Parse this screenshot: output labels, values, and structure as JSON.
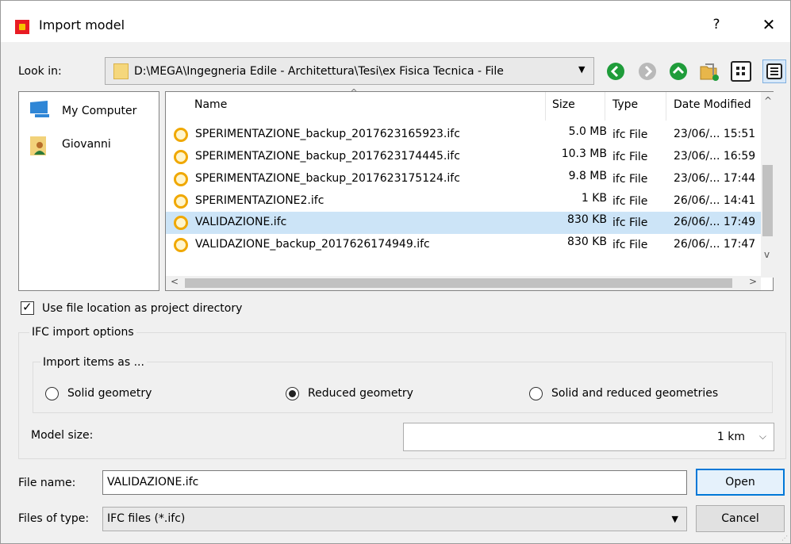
{
  "window": {
    "title": "Import model",
    "help_label": "?",
    "close_label": "✕"
  },
  "look_in": {
    "label": "Look in:",
    "path": "D:\\MEGA\\Ingegneria Edile - Architettura\\Tesi\\ex Fisica Tecnica - File",
    "arrow": "▼"
  },
  "places": [
    {
      "label": "My Computer",
      "icon": "computer-icon"
    },
    {
      "label": "Giovanni",
      "icon": "user-folder-icon"
    }
  ],
  "file_list": {
    "columns": [
      "Name",
      "Size",
      "Type",
      "Date Modified"
    ],
    "sort_indicator": "^",
    "rows": [
      {
        "name": "SPERIMENTAZIONE_backup_2017623165923.ifc",
        "size": "5.0 MB",
        "type": "ifc File",
        "date": "23/06/... 15:51",
        "selected": false
      },
      {
        "name": "SPERIMENTAZIONE_backup_2017623174445.ifc",
        "size": "10.3 MB",
        "type": "ifc File",
        "date": "23/06/... 16:59",
        "selected": false
      },
      {
        "name": "SPERIMENTAZIONE_backup_2017623175124.ifc",
        "size": "9.8 MB",
        "type": "ifc File",
        "date": "23/06/... 17:44",
        "selected": false
      },
      {
        "name": "SPERIMENTAZIONE2.ifc",
        "size": "1 KB",
        "type": "ifc File",
        "date": "26/06/... 14:41",
        "selected": false
      },
      {
        "name": "VALIDAZIONE.ifc",
        "size": "830 KB",
        "type": "ifc File",
        "date": "26/06/... 17:49",
        "selected": true
      },
      {
        "name": "VALIDAZIONE_backup_2017626174949.ifc",
        "size": "830 KB",
        "type": "ifc File",
        "date": "26/06/... 17:47",
        "selected": false
      }
    ],
    "scroll_up": "^",
    "scroll_down": "v",
    "scroll_left": "<",
    "scroll_right": ">"
  },
  "use_location": {
    "label": "Use file location as project directory",
    "checked": true,
    "check_mark": "✓"
  },
  "ifc_options": {
    "title": "IFC import options",
    "items_title": "Import items as ...",
    "radios": [
      {
        "label": "Solid geometry",
        "selected": false
      },
      {
        "label": "Reduced geometry",
        "selected": true
      },
      {
        "label": "Solid and reduced geometries",
        "selected": false
      }
    ],
    "model_size_label": "Model size:",
    "model_size_value": "1 km",
    "model_size_arrow": "⌵"
  },
  "file_name": {
    "label": "File name:",
    "value": "VALIDAZIONE.ifc"
  },
  "file_type": {
    "label": "Files of type:",
    "value": "IFC files (*.ifc)",
    "arrow": "▼"
  },
  "buttons": {
    "open": "Open",
    "cancel": "Cancel"
  },
  "colors": {
    "selection": "#cce4f7",
    "accent": "#0078d7",
    "nav_green": "#1f9c3a",
    "file_icon": "#f0a800"
  }
}
